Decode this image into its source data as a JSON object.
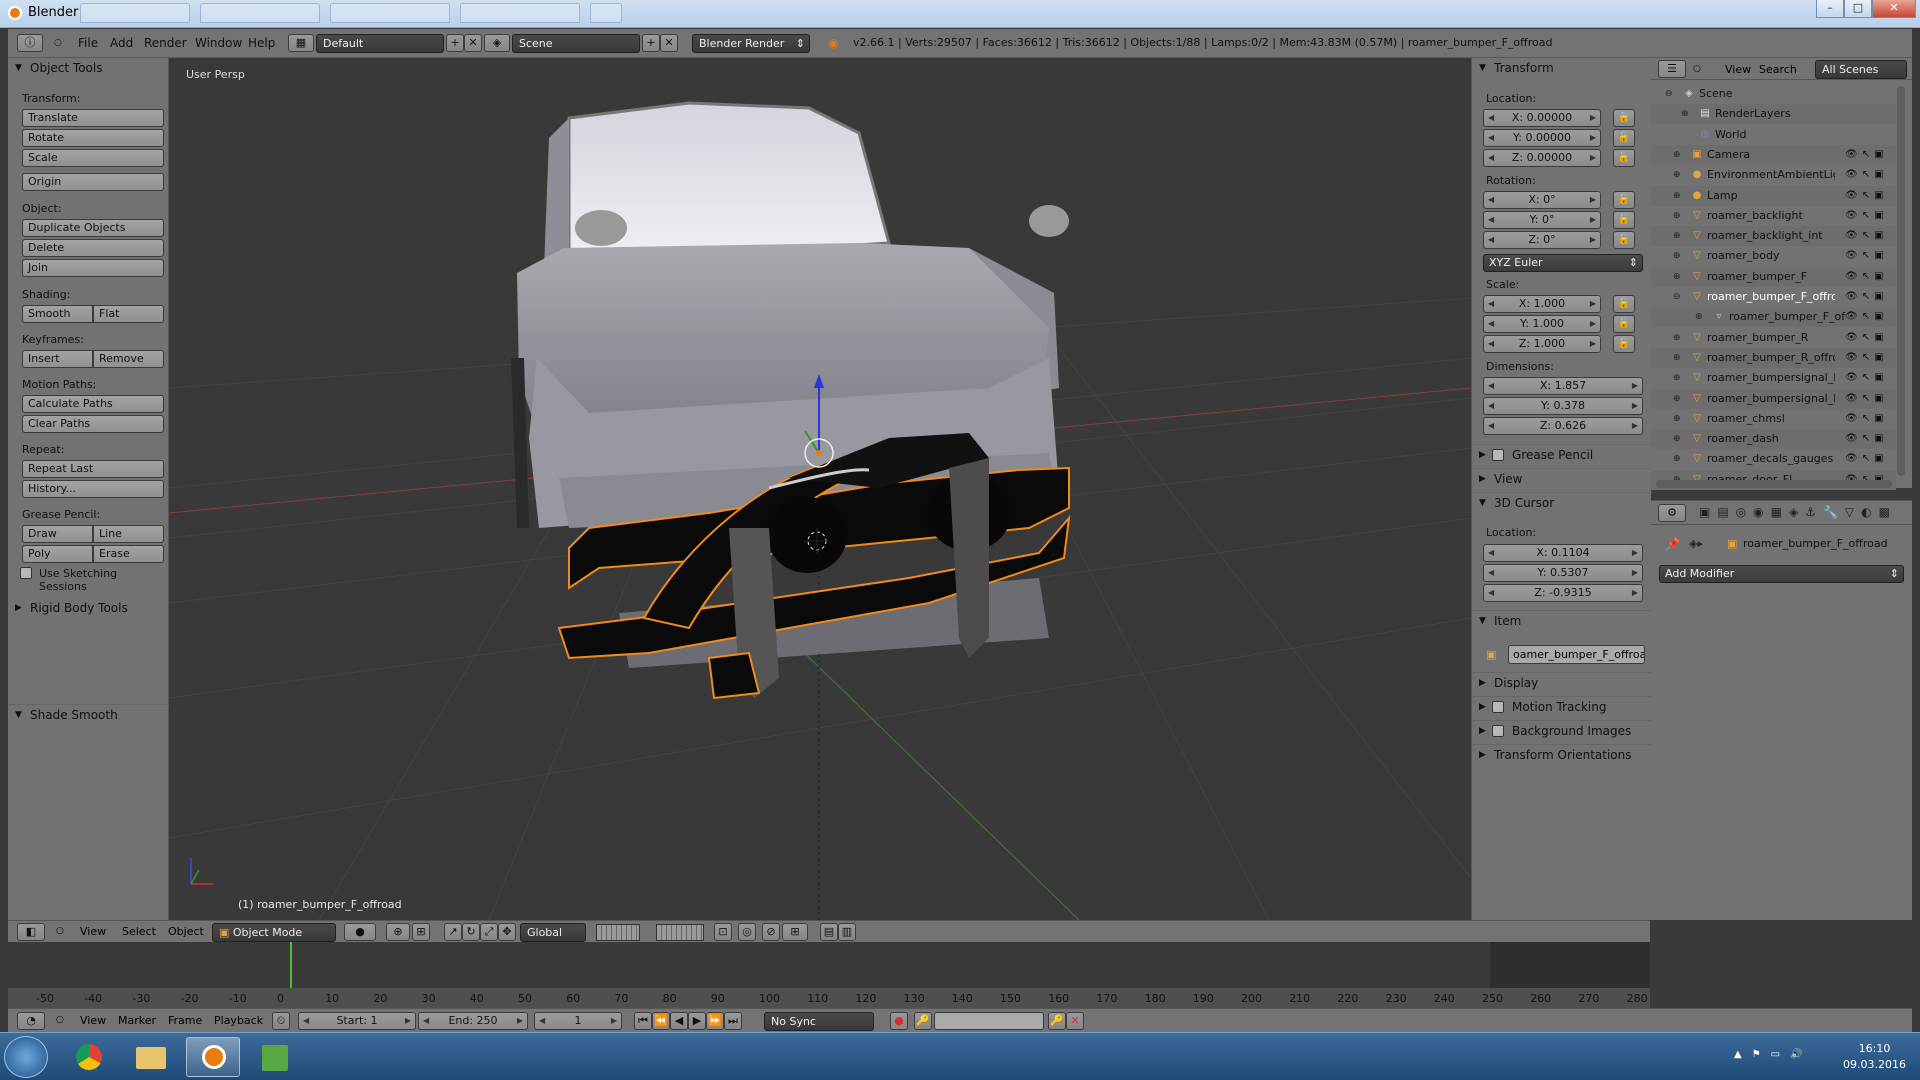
{
  "window": {
    "title": "Blender",
    "buttons": [
      "–",
      "□",
      "✕"
    ]
  },
  "topbar": {
    "menus": [
      "File",
      "Add",
      "Render",
      "Window",
      "Help"
    ],
    "layout": "Default",
    "scene": "Scene",
    "engine": "Blender Render",
    "stats": "v2.66.1 | Verts:29507 | Faces:36612 | Tris:36612 | Objects:1/88 | Lamps:0/2 | Mem:43.83M (0.57M) | roamer_bumper_F_offroad"
  },
  "toolshelf": {
    "title": "Object Tools",
    "transform_label": "Transform:",
    "translate": "Translate",
    "rotate": "Rotate",
    "scale": "Scale",
    "origin": "Origin",
    "object_label": "Object:",
    "duplicate": "Duplicate Objects",
    "delete": "Delete",
    "join": "Join",
    "shading_label": "Shading:",
    "smooth": "Smooth",
    "flat": "Flat",
    "keyframes_label": "Keyframes:",
    "insert": "Insert",
    "remove": "Remove",
    "motion_label": "Motion Paths:",
    "calc_paths": "Calculate Paths",
    "clear_paths": "Clear Paths",
    "repeat_label": "Repeat:",
    "repeat_last": "Repeat Last",
    "history": "History...",
    "grease_label": "Grease Pencil:",
    "draw": "Draw",
    "line": "Line",
    "poly": "Poly",
    "erase": "Erase",
    "sketch": "Use Sketching Sessions",
    "rigid": "Rigid Body Tools",
    "shade_smooth": "Shade Smooth"
  },
  "viewport": {
    "label": "User Persp",
    "object": "(1) roamer_bumper_F_offroad"
  },
  "npanel": {
    "transform": "Transform",
    "location_label": "Location:",
    "loc_x": "X: 0.00000",
    "loc_y": "Y: 0.00000",
    "loc_z": "Z: 0.00000",
    "rotation_label": "Rotation:",
    "rot_x": "X: 0°",
    "rot_y": "Y: 0°",
    "rot_z": "Z: 0°",
    "rot_mode": "XYZ Euler",
    "scale_label": "Scale:",
    "scl_x": "X: 1.000",
    "scl_y": "Y: 1.000",
    "scl_z": "Z: 1.000",
    "dim_label": "Dimensions:",
    "dim_x": "X: 1.857",
    "dim_y": "Y: 0.378",
    "dim_z": "Z: 0.626",
    "grease": "Grease Pencil",
    "view": "View",
    "cursor": "3D Cursor",
    "cursor_loc": "Location:",
    "cur_x": "X: 0.1104",
    "cur_y": "Y: 0.5307",
    "cur_z": "Z: -0.9315",
    "item": "Item",
    "item_name": "oamer_bumper_F_offroad",
    "display": "Display",
    "motion": "Motion Tracking",
    "bgimages": "Background Images",
    "orient": "Transform Orientations"
  },
  "outliner": {
    "view": "View",
    "search": "Search",
    "filter": "All Scenes",
    "rows": [
      {
        "name": "Scene",
        "icon": "scene-icon"
      },
      {
        "name": "RenderLayers",
        "icon": "renderlayers-icon"
      },
      {
        "name": "World",
        "icon": "world-icon"
      },
      {
        "name": "Camera",
        "icon": "camera-icon"
      },
      {
        "name": "EnvironmentAmbientLigh",
        "icon": "lamp-icon"
      },
      {
        "name": "Lamp",
        "icon": "lamp-icon"
      },
      {
        "name": "roamer_backlight",
        "icon": "mesh-icon"
      },
      {
        "name": "roamer_backlight_int",
        "icon": "mesh-icon"
      },
      {
        "name": "roamer_body",
        "icon": "mesh-icon"
      },
      {
        "name": "roamer_bumper_F",
        "icon": "mesh-icon"
      },
      {
        "name": "roamer_bumper_F_offroa",
        "icon": "mesh-icon"
      },
      {
        "name": "roamer_bumper_F_of",
        "icon": "mesh-data-icon"
      },
      {
        "name": "roamer_bumper_R",
        "icon": "mesh-icon"
      },
      {
        "name": "roamer_bumper_R_offroa",
        "icon": "mesh-icon"
      },
      {
        "name": "roamer_bumpersignal_FL",
        "icon": "mesh-icon"
      },
      {
        "name": "roamer_bumpersignal_FF",
        "icon": "mesh-icon"
      },
      {
        "name": "roamer_chmsl",
        "icon": "mesh-icon"
      },
      {
        "name": "roamer_dash",
        "icon": "mesh-icon"
      },
      {
        "name": "roamer_decals_gauges",
        "icon": "mesh-icon"
      },
      {
        "name": "roamer_door_FL",
        "icon": "mesh-icon"
      }
    ]
  },
  "modifiers": {
    "object": "roamer_bumper_F_offroad",
    "add": "Add Modifier"
  },
  "vpheader": {
    "menus": [
      "View",
      "Select",
      "Object"
    ],
    "mode": "Object Mode",
    "orientation": "Global"
  },
  "timeline": {
    "ticks": [
      "-50",
      "-40",
      "-30",
      "-20",
      "-10",
      "0",
      "10",
      "20",
      "30",
      "40",
      "50",
      "60",
      "70",
      "80",
      "90",
      "100",
      "110",
      "120",
      "130",
      "140",
      "150",
      "160",
      "170",
      "180",
      "190",
      "200",
      "210",
      "220",
      "230",
      "240",
      "250",
      "260",
      "270",
      "280"
    ],
    "menus": [
      "View",
      "Marker",
      "Frame",
      "Playback"
    ],
    "start": "Start: 1",
    "end": "End: 250",
    "current": "1",
    "sync": "No Sync"
  },
  "taskbar": {
    "time": "16:10",
    "date": "09.03.2016"
  },
  "colors": {
    "selection_outline": "#f08a1a",
    "viewport_bg": "#393939",
    "panel_bg": "#727272"
  }
}
